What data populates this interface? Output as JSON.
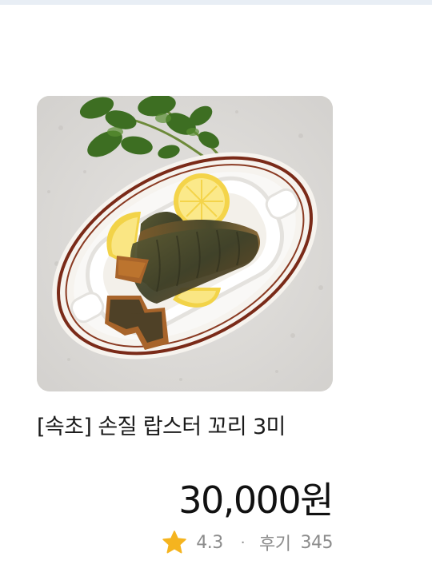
{
  "product": {
    "title": "[속초] 손질 랍스터 꼬리 3미",
    "price": "30,000원",
    "rating": "4.3",
    "separator": "·",
    "review_label": "후기",
    "review_count": "345",
    "image_alt": "손질 랍스터 꼬리",
    "image_icon": "lobster-tail-plate-photo"
  },
  "colors": {
    "star": "#f5b41f",
    "rating_text": "#8c8c8c",
    "price_text": "#111111",
    "title_text": "#1a1a1a"
  }
}
